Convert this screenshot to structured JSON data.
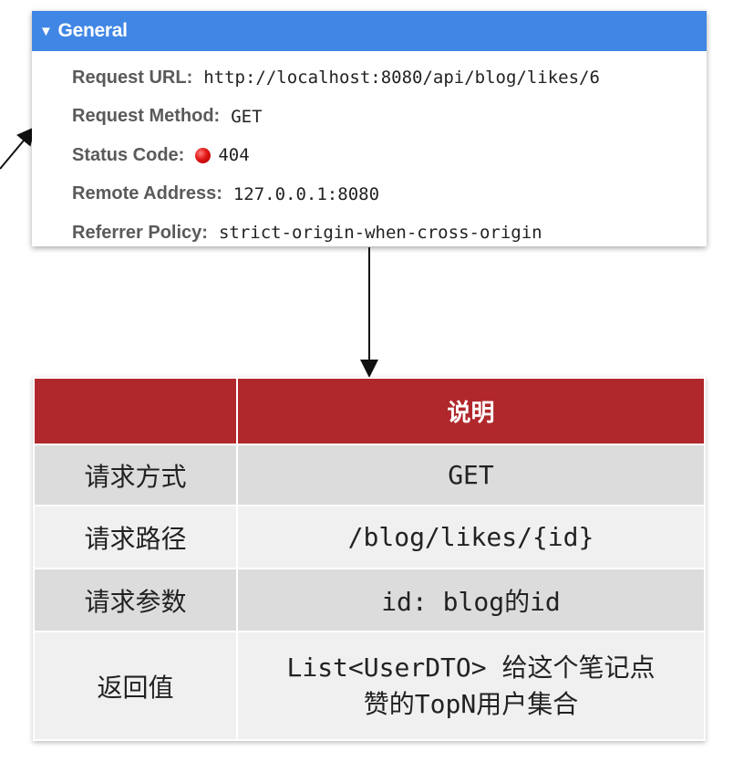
{
  "general": {
    "title": "General",
    "rows": [
      {
        "label": "Request URL:",
        "value": "http://localhost:8080/api/blog/likes/6"
      },
      {
        "label": "Request Method:",
        "value": "GET"
      },
      {
        "label": "Status Code:",
        "value": "404"
      },
      {
        "label": "Remote Address:",
        "value": "127.0.0.1:8080"
      },
      {
        "label": "Referrer Policy:",
        "value": "strict-origin-when-cross-origin"
      }
    ],
    "status_color": "#e01515",
    "header_color": "#3f86e5"
  },
  "api_table": {
    "header": [
      "",
      "说明"
    ],
    "rows": [
      {
        "key": "请求方式",
        "value": "GET"
      },
      {
        "key": "请求路径",
        "value": "/blog/likes/{id}"
      },
      {
        "key": "请求参数",
        "value": "id: blog的id"
      },
      {
        "key": "返回值",
        "value_line1": "List<UserDTO> 给这个笔记点",
        "value_line2": "赞的TopN用户集合"
      }
    ],
    "header_color": "#b0282c"
  }
}
